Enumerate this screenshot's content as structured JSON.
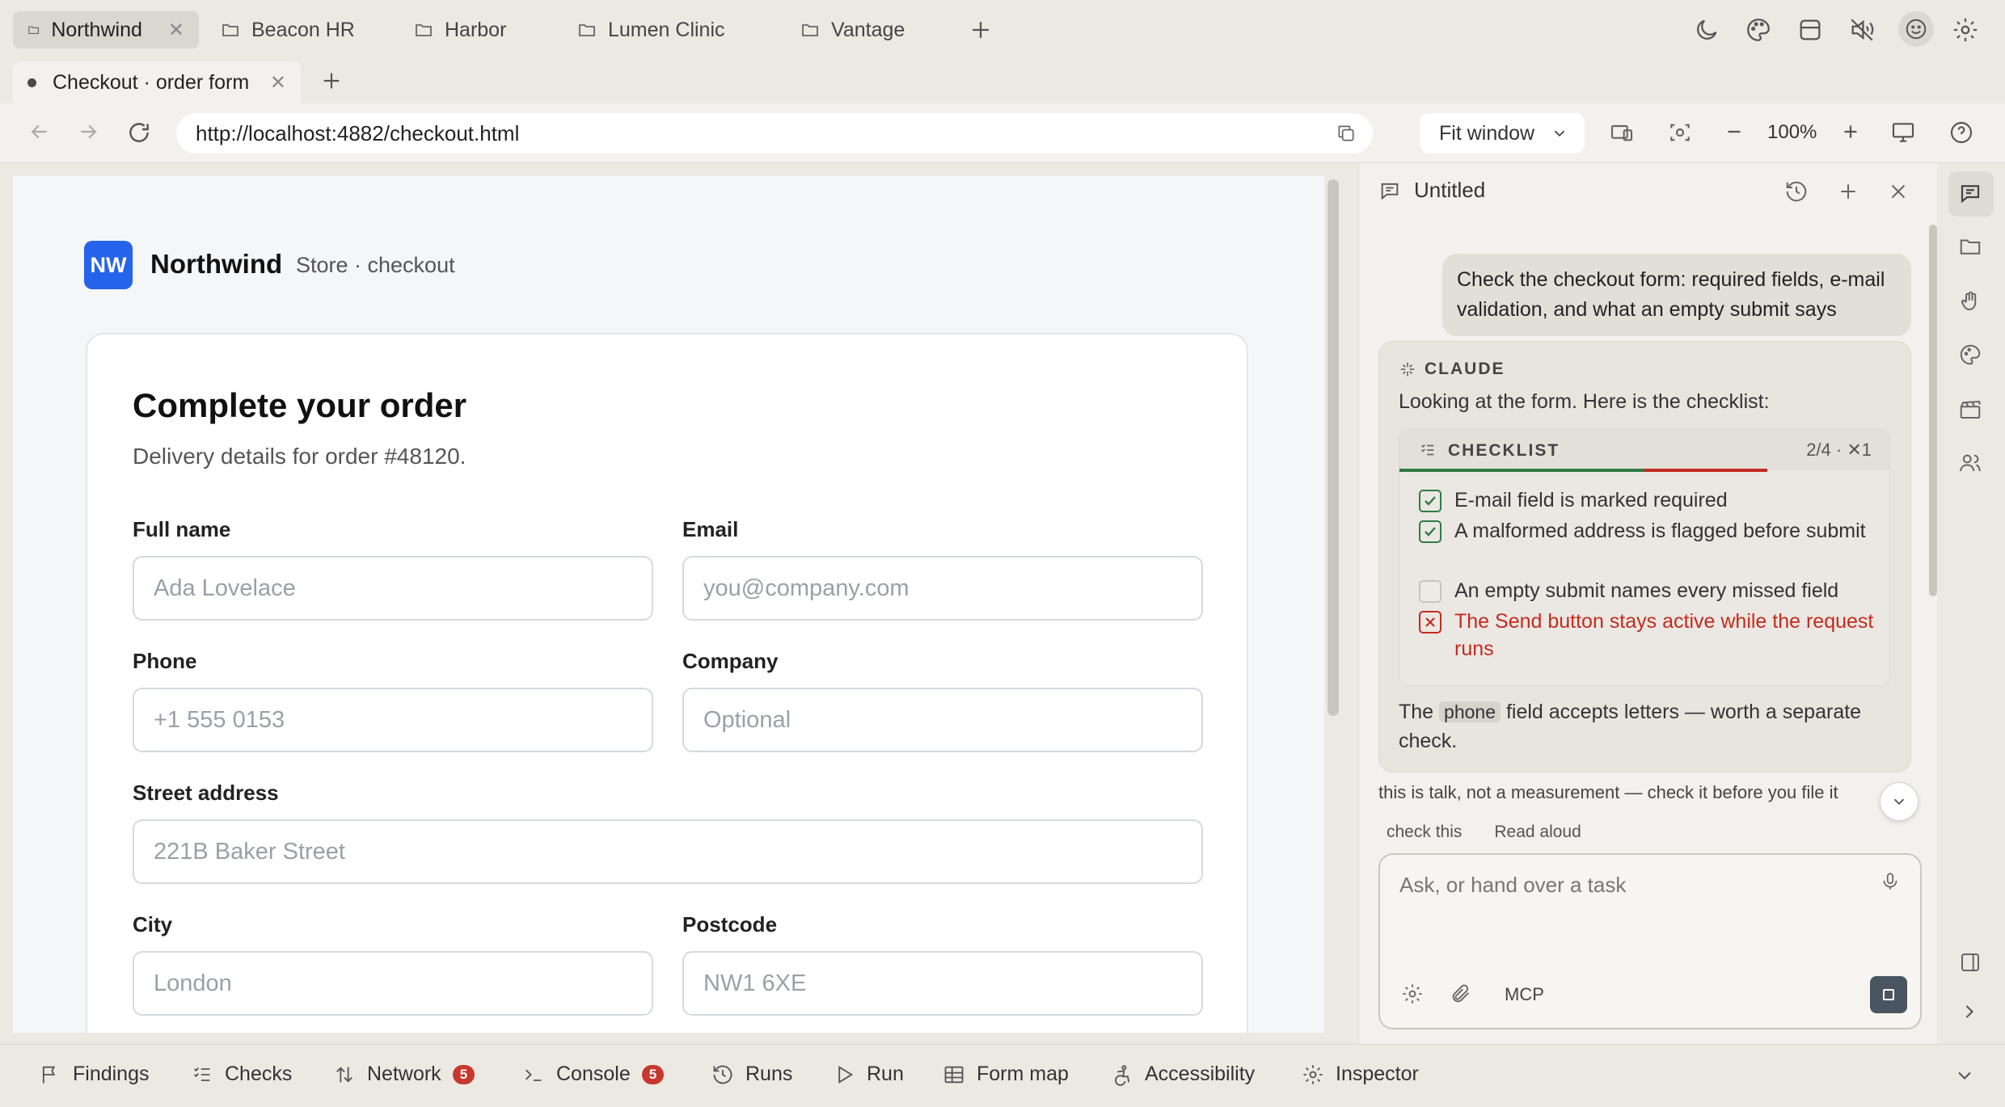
{
  "workspace_tabs": [
    {
      "label": "Northwind",
      "active": true
    },
    {
      "label": "Beacon HR",
      "active": false
    },
    {
      "label": "Harbor",
      "active": false
    },
    {
      "label": "Lumen Clinic",
      "active": false
    },
    {
      "label": "Vantage",
      "active": false
    }
  ],
  "page_tab": {
    "label": "Checkout · order form"
  },
  "toolbar": {
    "url": "http://localhost:4882/checkout.html",
    "fit_mode": "Fit window",
    "zoom": "100%"
  },
  "page": {
    "logo_text": "NW",
    "brand": "Northwind",
    "brand_sub": "Store · checkout",
    "title": "Complete your order",
    "subtitle": "Delivery details for order #48120.",
    "fields": {
      "full_name": {
        "label": "Full name",
        "placeholder": "Ada Lovelace"
      },
      "email": {
        "label": "Email",
        "placeholder": "you@company.com"
      },
      "phone": {
        "label": "Phone",
        "placeholder": "+1 555 0153"
      },
      "company": {
        "label": "Company",
        "placeholder": "Optional"
      },
      "street": {
        "label": "Street address",
        "placeholder": "221B Baker Street"
      },
      "city": {
        "label": "City",
        "placeholder": "London"
      },
      "postcode": {
        "label": "Postcode",
        "placeholder": "NW1 6XE"
      }
    }
  },
  "chat": {
    "title": "Untitled",
    "user_message": "Check the checkout form: required fields, e-mail validation, and what an empty submit says",
    "assistant_label": "CLAUDE",
    "reply_intro": "Looking at the form. Here is the checklist:",
    "checklist": {
      "title": "CHECKLIST",
      "count": "2/4 · ✕1",
      "passed_fraction": 0.5,
      "failed_fraction": 0.25,
      "items": [
        {
          "text": "E-mail field is marked required",
          "state": "pass"
        },
        {
          "text": "A malformed address is flagged before submit",
          "state": "pass"
        },
        {
          "text": "An empty submit names every missed field",
          "state": "pending"
        },
        {
          "text": "The Send button stays active while the request runs",
          "state": "fail"
        }
      ]
    },
    "tail_before": "The",
    "tail_code": "phone",
    "tail_after": "field accepts letters — worth a separate check.",
    "disclaimer": "this is talk, not a measurement — check it before you file it",
    "chips": [
      "check this",
      "Read aloud"
    ],
    "composer_placeholder": "Ask, or hand over a task",
    "mcp_label": "MCP"
  },
  "bottom_tabs": [
    {
      "label": "Findings",
      "icon": "flag-icon"
    },
    {
      "label": "Checks",
      "icon": "checklist-icon"
    },
    {
      "label": "Network",
      "icon": "arrows-updown-icon",
      "badge": "5"
    },
    {
      "label": "Console",
      "icon": "terminal-icon",
      "badge": "5"
    },
    {
      "label": "Runs",
      "icon": "history-icon"
    },
    {
      "label": "Run",
      "icon": "play-icon"
    },
    {
      "label": "Form map",
      "icon": "table-icon"
    },
    {
      "label": "Accessibility",
      "icon": "accessibility-icon"
    },
    {
      "label": "Inspector",
      "icon": "inspector-icon"
    }
  ],
  "colors": {
    "accent": "#2563eb",
    "pass": "#2f7a45",
    "fail": "#c42b1f",
    "badge": "#c8372d"
  }
}
